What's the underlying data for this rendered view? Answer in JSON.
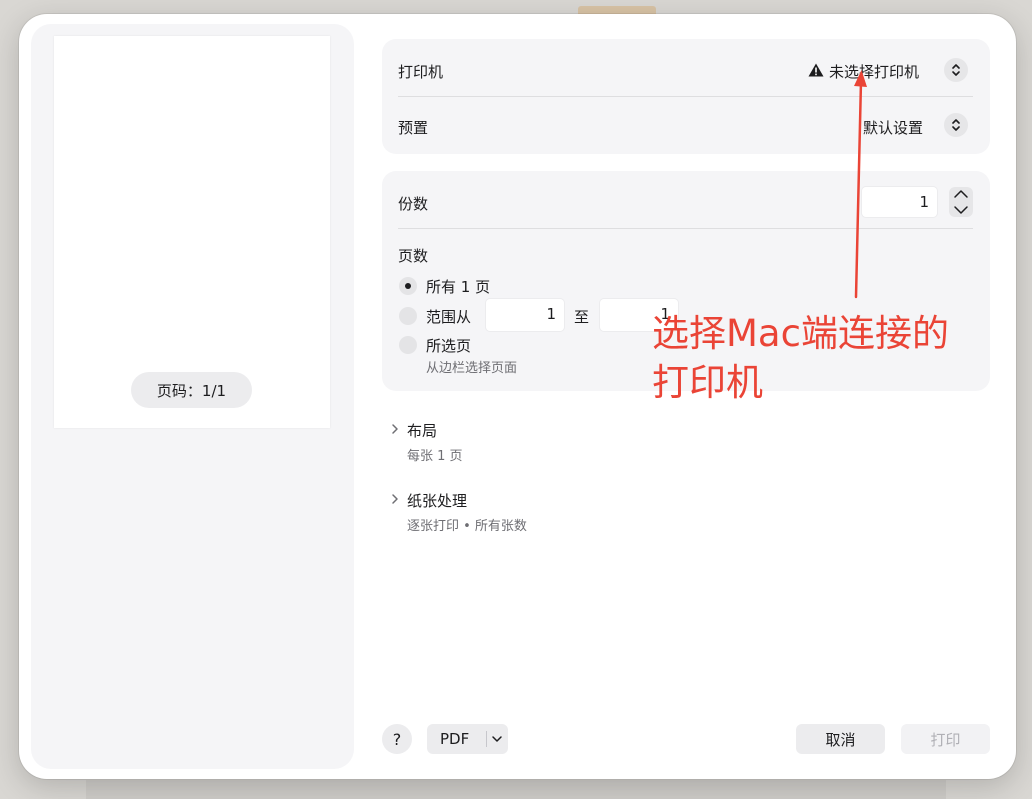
{
  "preview": {
    "page_indicator": "页码：1/1"
  },
  "printer_card": {
    "printer_label": "打印机",
    "printer_value": "未选择打印机",
    "preset_label": "预置",
    "preset_value": "默认设置"
  },
  "copies_card": {
    "copies_label": "份数",
    "copies_value": "1",
    "pages_label": "页数",
    "options": {
      "all": "所有 1 页",
      "range": "范围从",
      "selected": "所选页"
    },
    "range_from": "1",
    "range_to_label": "至",
    "range_to": "1",
    "selected_hint": "从边栏选择页面",
    "selected_option": "all"
  },
  "sections": {
    "layout": {
      "title": "布局",
      "summary": "每张 1 页"
    },
    "paper": {
      "title": "纸张处理",
      "summary": "逐张打印 • 所有张数"
    }
  },
  "footer": {
    "help_label": "?",
    "pdf_label": "PDF",
    "cancel_label": "取消",
    "print_label": "打印"
  },
  "annotation": {
    "line1": "选择Mac端连接的",
    "line2": "打印机",
    "color": "#ea4436"
  }
}
